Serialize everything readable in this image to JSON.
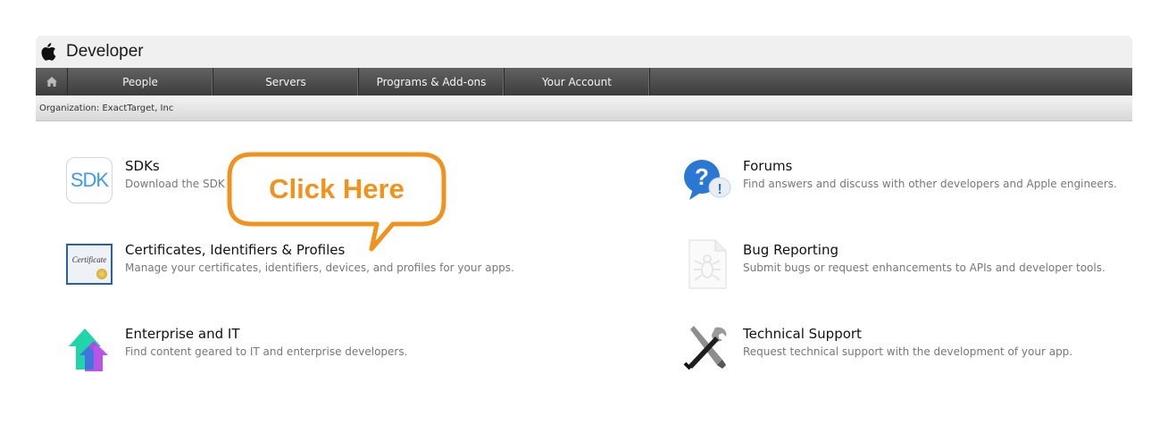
{
  "header": {
    "brand": "Developer"
  },
  "nav": {
    "items": [
      {
        "label": "People"
      },
      {
        "label": "Servers"
      },
      {
        "label": "Programs & Add-ons"
      },
      {
        "label": "Your Account"
      }
    ]
  },
  "org": {
    "label": "Organization: ExactTarget, Inc"
  },
  "tiles": {
    "sdks": {
      "title": "SDKs",
      "desc": "Download the SDK",
      "icon_text": "SDK"
    },
    "certs": {
      "title": "Certificates, Identifiers & Profiles",
      "desc": "Manage your certificates, identifiers, devices, and profiles for your apps.",
      "icon_text": "Certificate"
    },
    "enterprise": {
      "title": "Enterprise and IT",
      "desc": "Find content geared to IT and enterprise developers."
    },
    "forums": {
      "title": "Forums",
      "desc": "Find answers and discuss with other developers and Apple engineers."
    },
    "bug": {
      "title": "Bug Reporting",
      "desc": "Submit bugs or request enhancements to APIs and developer tools."
    },
    "support": {
      "title": "Technical Support",
      "desc": "Request technical support with the development of your app."
    }
  },
  "callout": {
    "label": "Click Here",
    "color": "#f0921c"
  }
}
